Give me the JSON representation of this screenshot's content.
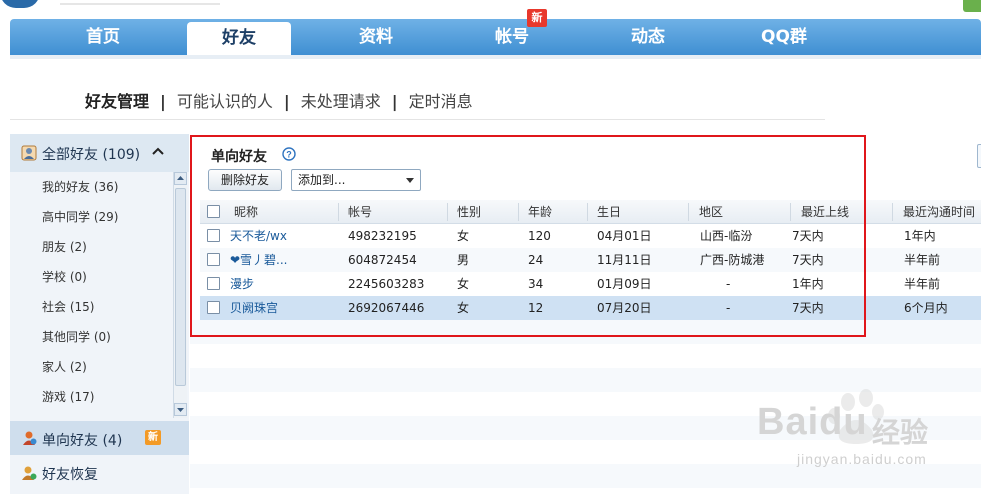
{
  "nav": {
    "tabs": [
      {
        "label": "首页"
      },
      {
        "label": "好友"
      },
      {
        "label": "资料"
      },
      {
        "label": "帐号"
      },
      {
        "label": "动态"
      },
      {
        "label": "QQ群"
      }
    ],
    "new_badge": "新"
  },
  "subnav": {
    "items": [
      "好友管理",
      "可能认识的人",
      "未处理请求",
      "定时消息"
    ],
    "separator": "|"
  },
  "sidebar": {
    "all_friends": "全部好友 (109)",
    "groups": [
      "我的好友 (36)",
      "高中同学 (29)",
      "朋友 (2)",
      "学校 (0)",
      "社会 (15)",
      "其他同学 (0)",
      "家人 (2)",
      "游戏 (17)"
    ],
    "one_way": "单向好友 (4)",
    "one_way_badge": "新",
    "recover": "好友恢复"
  },
  "main": {
    "title": "单向好友",
    "delete_button": "删除好友",
    "add_to_select": "添加到...",
    "columns": [
      "昵称",
      "帐号",
      "性别",
      "年龄",
      "生日",
      "地区",
      "最近上线",
      "最近沟通时间"
    ],
    "rows": [
      [
        "天不老/wx",
        "498232195",
        "女",
        "120",
        "04月01日",
        "山西-临汾",
        "7天内",
        "1年内"
      ],
      [
        "❤雪丿碧...",
        "604872454",
        "男",
        "24",
        "11月11日",
        "广西-防城港",
        "7天内",
        "半年前"
      ],
      [
        "漫步",
        "2245603283",
        "女",
        "34",
        "01月09日",
        "-",
        "1年内",
        "半年前"
      ],
      [
        "贝阙珠宫",
        "2692067446",
        "女",
        "12",
        "07月20日",
        "-",
        "7天内",
        "6个月内"
      ]
    ]
  },
  "watermark": {
    "brand": "Baidu",
    "cn": "经验",
    "url": "jingyan.baidu.com"
  },
  "colors": {
    "nav_blue": "#4f9bd9",
    "highlight_red": "#e0161b",
    "link_blue": "#1a5a9a",
    "selected_row": "#cfe1f3"
  }
}
